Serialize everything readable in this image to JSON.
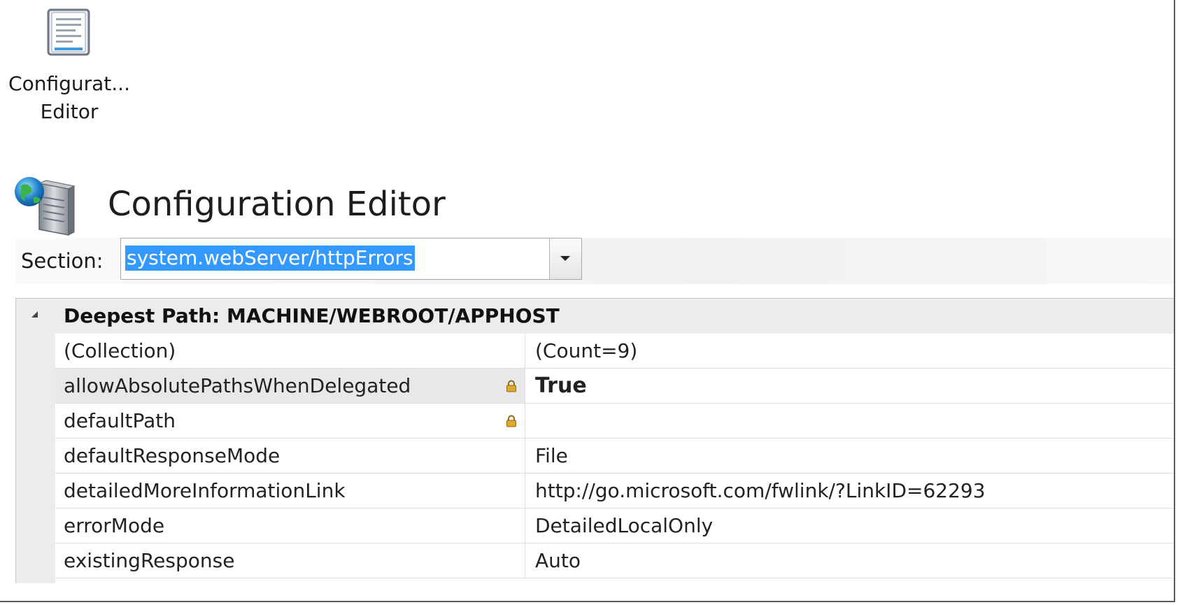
{
  "feature_tile": {
    "label_line1": "Configurat...",
    "label_line2": "Editor",
    "icon": "document-icon"
  },
  "header": {
    "title": "Configuration Editor",
    "icon": "server-globe-icon"
  },
  "section": {
    "label": "Section:",
    "value": "system.webServer/httpErrors"
  },
  "grid": {
    "category": "Deepest Path: MACHINE/WEBROOT/APPHOST",
    "rows": [
      {
        "name": "(Collection)",
        "value": "(Count=9)",
        "locked": false,
        "bold": false,
        "selected": false
      },
      {
        "name": "allowAbsolutePathsWhenDelegated",
        "value": "True",
        "locked": true,
        "bold": true,
        "selected": true
      },
      {
        "name": "defaultPath",
        "value": "",
        "locked": true,
        "bold": false,
        "selected": false
      },
      {
        "name": "defaultResponseMode",
        "value": "File",
        "locked": false,
        "bold": false,
        "selected": false
      },
      {
        "name": "detailedMoreInformationLink",
        "value": "http://go.microsoft.com/fwlink/?LinkID=62293",
        "locked": false,
        "bold": false,
        "selected": false
      },
      {
        "name": "errorMode",
        "value": "DetailedLocalOnly",
        "locked": false,
        "bold": false,
        "selected": false
      },
      {
        "name": "existingResponse",
        "value": "Auto",
        "locked": false,
        "bold": false,
        "selected": false
      }
    ]
  },
  "colors": {
    "selection_highlight": "#3399ff",
    "grid_gutter": "#ececec",
    "lock": "#d9a21b"
  }
}
